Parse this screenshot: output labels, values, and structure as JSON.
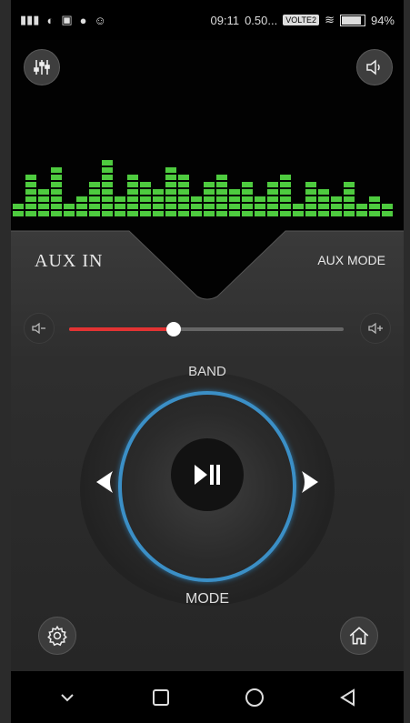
{
  "status_bar": {
    "time": "09:11",
    "speed": "0.50...",
    "network_badge": "VOLTE2",
    "battery_percent": "94%",
    "battery_level": 0.94
  },
  "header": {
    "equalizer_icon": "equalizer-icon",
    "speaker_icon": "speaker-icon"
  },
  "source": {
    "label": "AUX IN",
    "mode_label": "AUX MODE"
  },
  "volume": {
    "level": 0.38,
    "down_icon": "volume-down-icon",
    "up_icon": "volume-up-icon",
    "track_color": "#666666",
    "fill_color": "#e33333"
  },
  "knob": {
    "top_label": "BAND",
    "bottom_label": "MODE",
    "ring_color": "#3b8fc6",
    "center_icon": "play-pause-icon"
  },
  "footer": {
    "settings_icon": "gear-icon",
    "home_icon": "home-icon"
  },
  "nav": {
    "items": [
      "chevron-down-icon",
      "square-icon",
      "circle-icon",
      "back-triangle-icon"
    ]
  },
  "colors": {
    "visualizer_bar": "#4ecb3f",
    "background": "#262626"
  }
}
